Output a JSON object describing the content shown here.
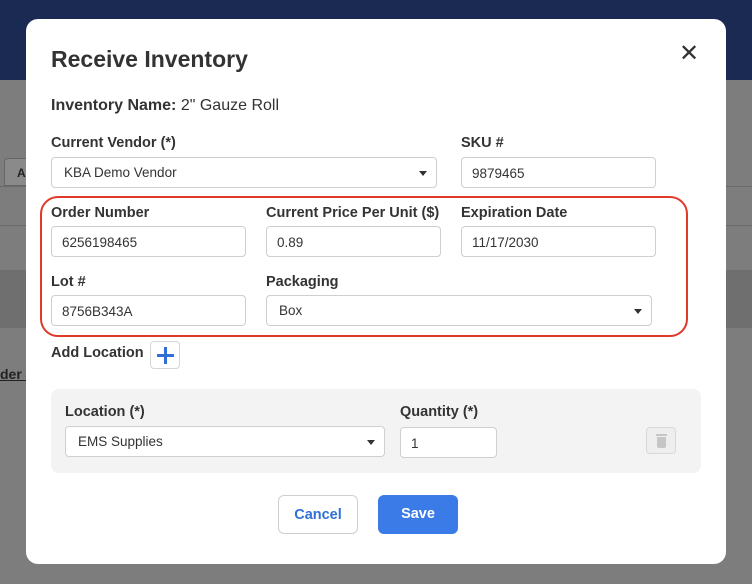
{
  "background": {
    "tab_label": "A",
    "row_text": "der #"
  },
  "modal": {
    "title": "Receive Inventory",
    "close_label": "✕",
    "inventory_name_label": "Inventory Name:",
    "inventory_name_value": "2\" Gauze Roll"
  },
  "form": {
    "current_vendor": {
      "label": "Current Vendor (*)",
      "value": "KBA Demo Vendor"
    },
    "sku": {
      "label": "SKU #",
      "value": "9879465"
    },
    "order_number": {
      "label": "Order Number",
      "value": "6256198465"
    },
    "current_price": {
      "label": "Current Price Per Unit ($)",
      "value": "0.89"
    },
    "expiration_date": {
      "label": "Expiration Date",
      "value": "11/17/2030"
    },
    "lot": {
      "label": "Lot #",
      "value": "8756B343A"
    },
    "packaging": {
      "label": "Packaging",
      "value": "Box"
    }
  },
  "add_location": {
    "label": "Add Location"
  },
  "location_row": {
    "location": {
      "label": "Location (*)",
      "value": "EMS Supplies"
    },
    "quantity": {
      "label": "Quantity (*)",
      "value": "1"
    }
  },
  "actions": {
    "cancel_label": "Cancel",
    "save_label": "Save"
  },
  "colors": {
    "accent": "#3b7be8",
    "highlight": "#e0392a",
    "topbar": "#1a2a52"
  }
}
